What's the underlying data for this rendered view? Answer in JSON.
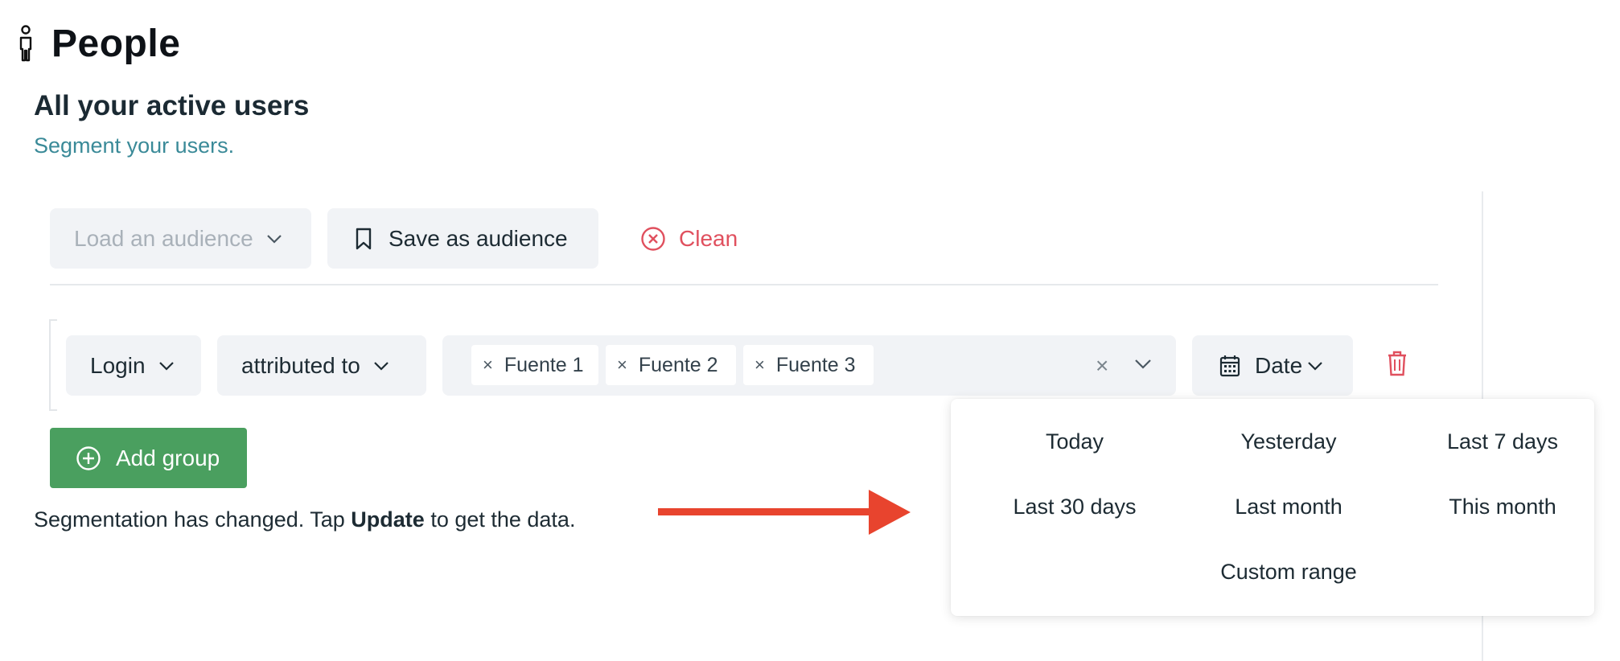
{
  "header": {
    "title": "People",
    "icon": "person-icon"
  },
  "section": {
    "title": "All your active users",
    "subtitle": "Segment your users."
  },
  "toolbar": {
    "load_audience_placeholder": "Load an audience",
    "save_audience_label": "Save as audience",
    "clean_label": "Clean"
  },
  "filter_group": {
    "event_select": "Login",
    "relation_select": "attributed to",
    "sources": [
      "Fuente 1",
      "Fuente 2",
      "Fuente 3"
    ],
    "chip_remove_glyph": "×",
    "clear_glyph": "×",
    "date_label": "Date"
  },
  "add_group_label": "Add group",
  "segmentation_message": {
    "before": "Segmentation has changed. Tap ",
    "emphasis": "Update",
    "after": " to get the data."
  },
  "date_presets": [
    [
      "Today",
      "Yesterday",
      "Last 7 days"
    ],
    [
      "Last 30 days",
      "Last month",
      "This month"
    ],
    [
      "",
      "Custom range",
      ""
    ]
  ],
  "colors": {
    "accent_green": "#4a9f5f",
    "danger_red": "#e0505e",
    "annotation_arrow": "#e8442e",
    "subtitle_teal": "#3a8a98"
  }
}
